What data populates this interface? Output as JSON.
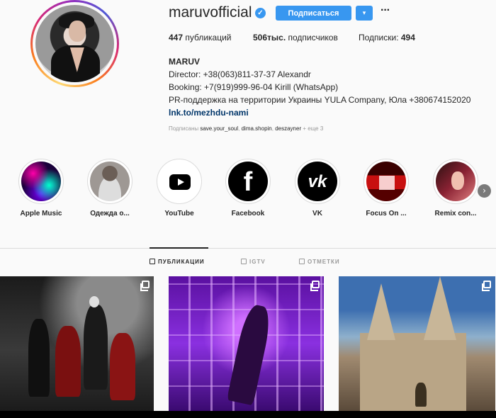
{
  "profile": {
    "username": "maruvofficial",
    "verified_glyph": "✓",
    "follow_label": "Подписаться",
    "dropdown_glyph": "▾",
    "more_glyph": "···",
    "stats": {
      "posts_count": "447",
      "posts_label": " публикаций",
      "followers_count": "506тыс.",
      "followers_label": " подписчиков",
      "following_label": "Подписки: ",
      "following_count": "494"
    },
    "bio": {
      "name": "MARUV",
      "line1": "Director: +38(063)811-37-37 Alexandr",
      "line2": "Booking: +7(919)999-96-04 Kirill (WhatsApp)",
      "line3": "PR-поддержка на территории Украины YULA Company, Юла +380674152020",
      "link": "lnk.to/mezhdu-nami"
    },
    "followed_by": {
      "prefix": "Подписаны ",
      "user1": "save.your_soul",
      "sep1": ", ",
      "user2": "dima.shopin",
      "sep2": ", ",
      "user3": "deszayner",
      "more": " + еще 3"
    }
  },
  "highlights": [
    {
      "label": "Apple Music",
      "icon": "apple-music-highlight"
    },
    {
      "label": "Одежда о...",
      "icon": "clothing-highlight"
    },
    {
      "label": "YouTube",
      "icon": "youtube-icon"
    },
    {
      "label": "Facebook",
      "icon": "facebook-icon",
      "glyph": "f"
    },
    {
      "label": "VK",
      "icon": "vk-icon",
      "glyph": "vk"
    },
    {
      "label": "Focus On ...",
      "icon": "focus-highlight"
    },
    {
      "label": "Remix con...",
      "icon": "remix-highlight"
    }
  ],
  "highlights_next_glyph": "›",
  "tabs": [
    {
      "label": "ПУБЛИКАЦИИ",
      "icon": "grid-icon",
      "active": true
    },
    {
      "label": "IGTV",
      "icon": "igtv-icon",
      "active": false
    },
    {
      "label": "ОТМЕТКИ",
      "icon": "tagged-icon",
      "active": false
    }
  ],
  "posts": [
    {
      "icon": "multiple-photos-icon"
    },
    {
      "icon": "multiple-photos-icon"
    },
    {
      "icon": "multiple-photos-icon"
    }
  ],
  "colors": {
    "accent": "#3897f0",
    "link": "#003569",
    "muted": "#999999",
    "text": "#262626",
    "background": "#fafafa"
  }
}
